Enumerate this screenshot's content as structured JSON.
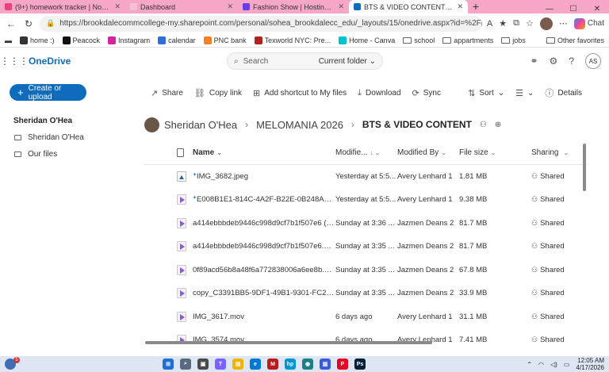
{
  "browser": {
    "tabs": [
      {
        "title": "(9+) homework tracker | Not Done",
        "color": "#e8447a",
        "active": false
      },
      {
        "title": "Dashboard",
        "color": "#f6c0d4",
        "active": false
      },
      {
        "title": "Fashion Show | Hostinger Website",
        "color": "#673de6",
        "active": false
      },
      {
        "title": "BTS & VIDEO CONTENT - OneDrive",
        "color": "#0f6cbd",
        "active": true
      }
    ],
    "url": "https://brookdalecommcollege-my.sharepoint.com/personal/sohea_brookdalecc_edu/_layouts/15/onedrive.aspx?id=%2Fpersonal%2Fsohea_...",
    "chat_label": "Chat",
    "bookmarks": [
      {
        "label": "home :)",
        "kind": "icon",
        "color": "#333333"
      },
      {
        "label": "Peacock",
        "kind": "icon",
        "color": "#111111"
      },
      {
        "label": "Instagram",
        "kind": "icon",
        "color": "#d6249f"
      },
      {
        "label": "calendar",
        "kind": "icon",
        "color": "#2f6fd6"
      },
      {
        "label": "PNC bank",
        "kind": "icon",
        "color": "#f58025"
      },
      {
        "label": "Texworld NYC: Pre...",
        "kind": "icon",
        "color": "#b22222"
      },
      {
        "label": "Home - Canva",
        "kind": "icon",
        "color": "#00c4cc"
      },
      {
        "label": "school",
        "kind": "folder",
        "color": "#666666"
      },
      {
        "label": "appartments",
        "kind": "folder",
        "color": "#666666"
      },
      {
        "label": "jobs",
        "kind": "folder",
        "color": "#666666"
      }
    ],
    "other_favorites": "Other favorites"
  },
  "header": {
    "app_name": "OneDrive",
    "search_placeholder": "Search",
    "search_scope": "Current folder",
    "user_initials": "AS"
  },
  "leftnav": {
    "create_label": "Create or upload",
    "user_name": "Sheridan O'Hea",
    "items": [
      {
        "label": "Sheridan O'Hea"
      },
      {
        "label": "Our files"
      }
    ]
  },
  "commands": {
    "share": "Share",
    "copy_link": "Copy link",
    "add_shortcut": "Add shortcut to My files",
    "download": "Download",
    "sync": "Sync",
    "sort": "Sort",
    "details": "Details"
  },
  "breadcrumb": {
    "owner": "Sheridan O'Hea",
    "folder": "MELOMANIA 2026",
    "current": "BTS & VIDEO CONTENT"
  },
  "table": {
    "columns": {
      "name": "Name",
      "modified": "Modifie...",
      "modified_by": "Modified By",
      "file_size": "File size",
      "sharing": "Sharing"
    },
    "rows": [
      {
        "type": "image",
        "name": "IMG_3682.jpeg",
        "modified": "Yesterday at 5:5...",
        "by": "Avery Lenhard 1",
        "size": "1.81 MB",
        "sharing": "Shared",
        "new": true
      },
      {
        "type": "video",
        "name": "E008B1E1-814C-4A2F-B22E-0B248AF92F...",
        "modified": "Yesterday at 5:5...",
        "by": "Avery Lenhard 1",
        "size": "9.38 MB",
        "sharing": "Shared",
        "new": true
      },
      {
        "type": "video",
        "name": "a414ebbbdeb9446c998d9cf7b1f507e6 (1)...",
        "modified": "Sunday at 3:36 ...",
        "by": "Jazmen Deans 2",
        "size": "81.7 MB",
        "sharing": "Shared",
        "new": false
      },
      {
        "type": "video",
        "name": "a414ebbbdeb9446c998d9cf7b1f507e6.MOV",
        "modified": "Sunday at 3:35 ...",
        "by": "Jazmen Deans 2",
        "size": "81.7 MB",
        "sharing": "Shared",
        "new": false
      },
      {
        "type": "video",
        "name": "0f89acd56b8a48f6a772838006a6ee8b.MOV",
        "modified": "Sunday at 3:35 ...",
        "by": "Jazmen Deans 2",
        "size": "67.8 MB",
        "sharing": "Shared",
        "new": false
      },
      {
        "type": "video",
        "name": "copy_C3391BB5-9DF1-49B1-9301-FC214C...",
        "modified": "Sunday at 3:35 ...",
        "by": "Jazmen Deans 2",
        "size": "33.9 MB",
        "sharing": "Shared",
        "new": false
      },
      {
        "type": "video",
        "name": "IMG_3617.mov",
        "modified": "6 days ago",
        "by": "Avery Lenhard 1",
        "size": "31.1 MB",
        "sharing": "Shared",
        "new": false
      },
      {
        "type": "video",
        "name": "IMG_3574.mov",
        "modified": "6 days ago",
        "by": "Avery Lenhard 1",
        "size": "7.41 MB",
        "sharing": "Shared",
        "new": false
      }
    ]
  },
  "taskbar": {
    "notification_count": "5",
    "time": "12:05 AM",
    "date": "4/17/2026"
  }
}
